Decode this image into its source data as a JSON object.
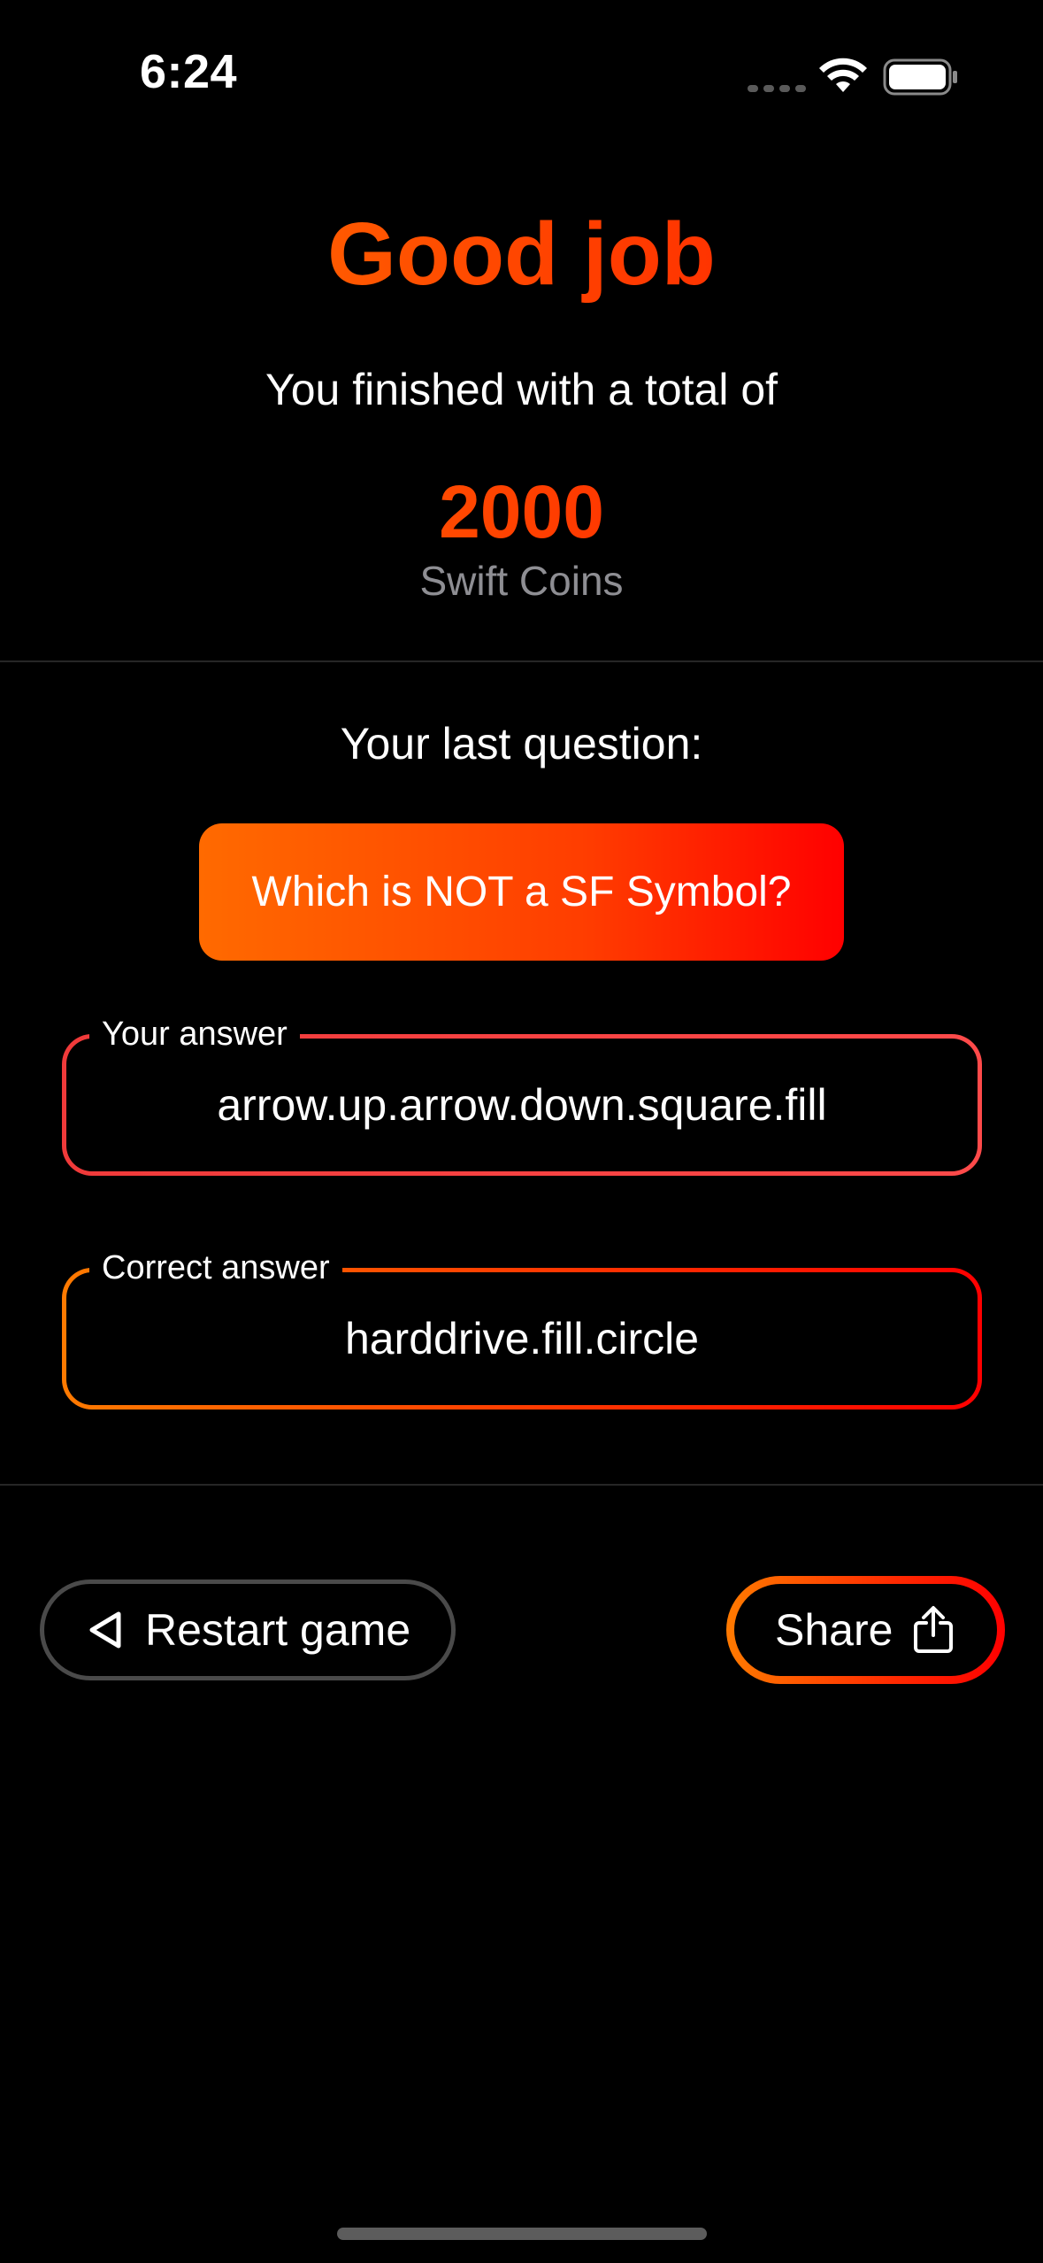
{
  "status_bar": {
    "time": "6:24"
  },
  "header": {
    "title": "Good job",
    "subtitle": "You finished with a total of",
    "coins_value": "2000",
    "coins_label": "Swift Coins"
  },
  "last_question": {
    "label": "Your last question:",
    "question": "Which is NOT a SF Symbol?"
  },
  "answers": {
    "yours": {
      "label": "Your answer",
      "value": "arrow.up.arrow.down.square.fill"
    },
    "correct": {
      "label": "Correct answer",
      "value": "harddrive.fill.circle"
    }
  },
  "actions": {
    "restart_label": "Restart game",
    "restart_icon": "chevron-left-triangle-icon",
    "share_label": "Share",
    "share_icon": "share-icon"
  },
  "colors": {
    "accent_start": "#ff7a00",
    "accent_end": "#ff0000",
    "wrong_answer": "#f03a3a",
    "secondary_text": "#8e8e93"
  }
}
